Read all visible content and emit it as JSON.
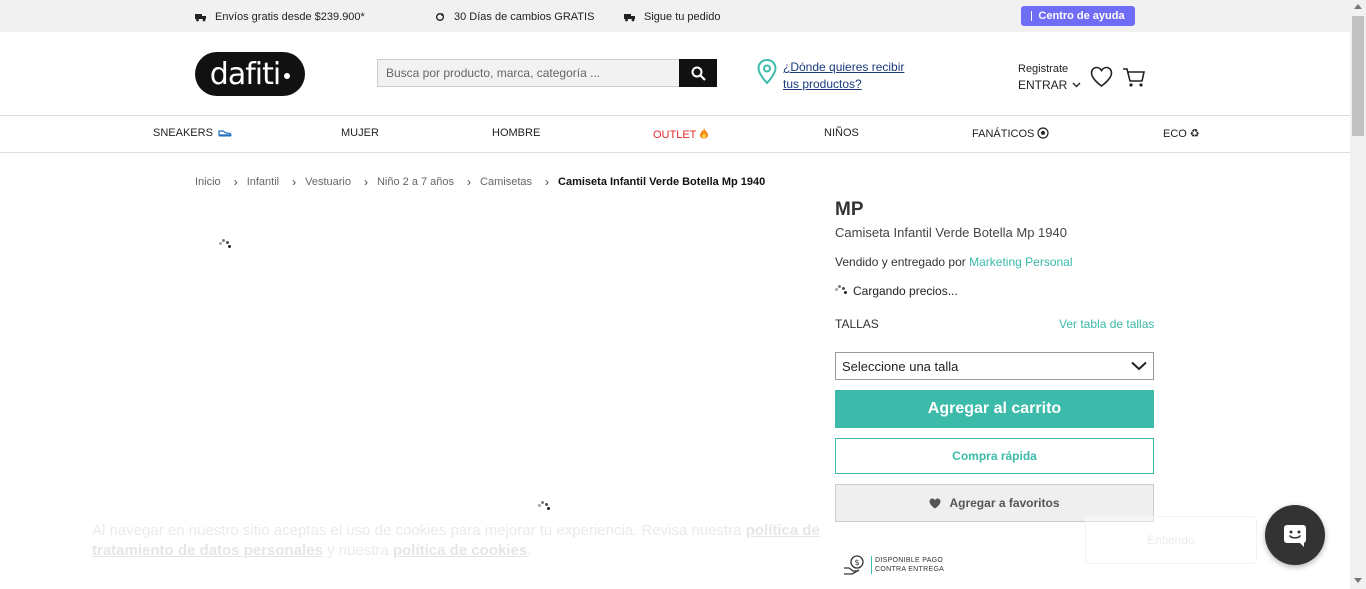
{
  "topbar": {
    "promo_shipping": "Envíos gratis desde $239.900*",
    "promo_exchange": "30 Días de cambios GRATIS",
    "promo_tracking": "Sigue tu pedido",
    "help_label": "Centro de ayuda"
  },
  "header": {
    "logo_text": "dafiti",
    "search_placeholder": "Busca por producto, marca, categoría ...",
    "location_line1": "¿Dónde quieres recibir",
    "location_line2": "tus productos?",
    "register_label": "Registrate",
    "login_label": "ENTRAR"
  },
  "nav": {
    "items": [
      {
        "label": "SNEAKERS",
        "icon": "sneaker-icon"
      },
      {
        "label": "MUJER"
      },
      {
        "label": "HOMBRE"
      },
      {
        "label": "OUTLET",
        "icon": "fire-icon"
      },
      {
        "label": "NIÑOS"
      },
      {
        "label": "FANÁTICOS",
        "icon": "soccer-ball-icon"
      },
      {
        "label": "ECO",
        "icon": "recycle-icon"
      }
    ]
  },
  "breadcrumb": {
    "items": [
      "Inicio",
      "Infantil",
      "Vestuario",
      "Niño 2 a 7 años",
      "Camisetas"
    ],
    "current": "Camiseta Infantil Verde Botella Mp 1940"
  },
  "product": {
    "brand": "MP",
    "name": "Camiseta Infantil Verde Botella Mp 1940",
    "seller_prefix": "Vendido y entregado por",
    "seller_name": "Marketing Personal",
    "loading_prices": "Cargando precios...",
    "sizes_label": "TALLAS",
    "size_guide_label": "Ver tabla de tallas",
    "size_select_value": "Seleccione una talla",
    "add_to_cart_label": "Agregar al carrito",
    "quick_buy_label": "Compra rápida",
    "add_to_favorites_label": "Agregar a favoritos",
    "payment_badge_line1": "DISPONIBLE PAGO",
    "payment_badge_line2": "CONTRA ENTREGA"
  },
  "cookie_banner": {
    "text_part1": "Al navegar en nuestro sitio aceptas el uso de cookies para mejorar tu experiencia. Revisa nuestra ",
    "link1": "política de tratamiento de datos personales",
    "text_part2": " y nuestra ",
    "link2": "política de cookies",
    "text_part3": ".",
    "accept_label": "Entiendo"
  },
  "colors": {
    "accent_teal": "#3cbbaa",
    "help_button": "#6f6cf5",
    "outlet_red": "#e02b2b",
    "chat_bubble": "#333333"
  }
}
